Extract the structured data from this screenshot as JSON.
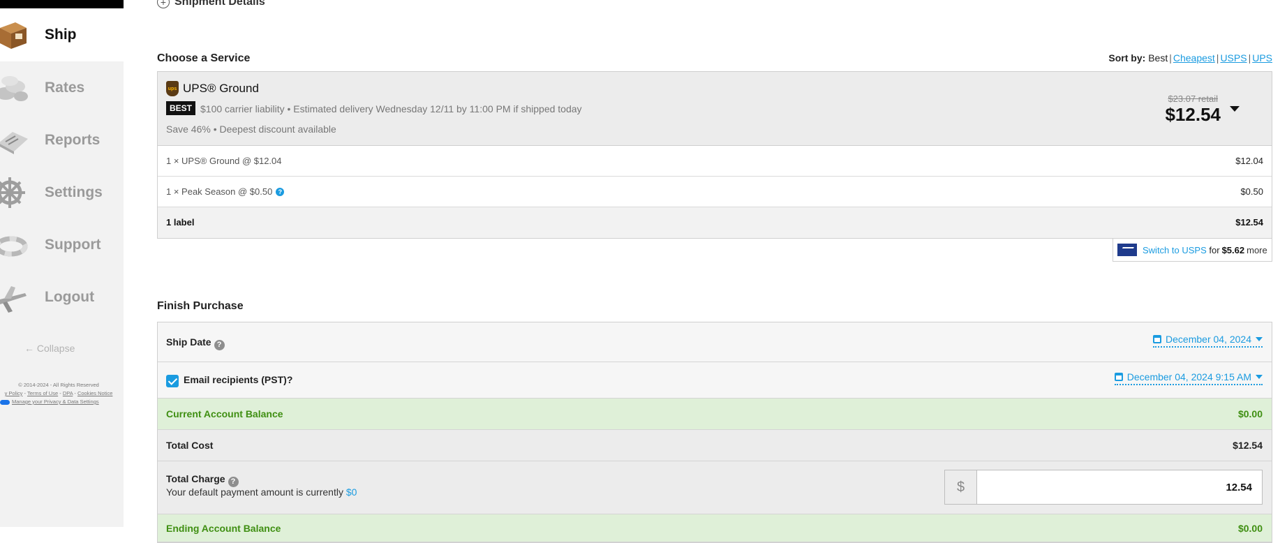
{
  "sidebar": {
    "items": [
      {
        "label": "Ship",
        "icon": "package-box-icon"
      },
      {
        "label": "Rates",
        "icon": "coins-icon"
      },
      {
        "label": "Reports",
        "icon": "reports-book-icon"
      },
      {
        "label": "Settings",
        "icon": "ship-wheel-icon"
      },
      {
        "label": "Support",
        "icon": "life-ring-icon"
      },
      {
        "label": "Logout",
        "icon": "airplane-icon"
      }
    ],
    "collapse_label": "← Collapse",
    "legal": {
      "copyright": "© 2014-2024 - All Rights Reserved",
      "privacy": "y Policy",
      "terms": "Terms of Use",
      "dpa": "DPA",
      "cookies": "Cookies Notice",
      "manage_privacy": "Manage your Privacy & Data Settings"
    }
  },
  "shipment_details": {
    "label": "Shipment Details"
  },
  "choose_service": {
    "title": "Choose a Service",
    "sort_label": "Sort by:",
    "sort_current": "Best",
    "sort_options": [
      "Cheapest",
      "USPS",
      "UPS"
    ],
    "service": {
      "name": "UPS® Ground",
      "logo_text": "ups",
      "badge": "BEST",
      "description": "$100 carrier liability • Estimated delivery Wednesday 12/11 by 11:00 PM if shipped today",
      "savings": "Save 46% • Deepest discount available",
      "retail_price": "$23.07 retail",
      "price": "$12.54"
    },
    "lines": [
      {
        "label": "1 × UPS® Ground @ $12.04",
        "amount": "$12.04"
      },
      {
        "label": "1 × Peak Season @ $0.50",
        "amount": "$0.50"
      }
    ],
    "total": {
      "label": "1 label",
      "amount": "$12.54"
    },
    "switch": {
      "link": "Switch to USPS",
      "for": "for",
      "amount": "$5.62",
      "suffix": "more"
    }
  },
  "finish_purchase": {
    "title": "Finish Purchase",
    "ship_date": {
      "label": "Ship Date",
      "value": "December 04, 2024"
    },
    "email": {
      "label": "Email recipients (PST)?",
      "value": "December 04, 2024 9:15 AM",
      "checked": true
    },
    "current_balance": {
      "label": "Current Account Balance",
      "value": "$0.00"
    },
    "total_cost": {
      "label": "Total Cost",
      "value": "$12.54"
    },
    "total_charge": {
      "label": "Total Charge",
      "sub_text": "Your default payment amount is currently",
      "sub_link": "$0",
      "currency": "$",
      "value": "12.54"
    },
    "ending_balance": {
      "label": "Ending Account Balance",
      "value": "$0.00"
    }
  },
  "colors": {
    "accent": "#1a9be0",
    "success": "#3f8f12",
    "success_bg": "#dff0d8",
    "ups_brown": "#5a3a14",
    "usps_blue": "#1f3b8c"
  }
}
